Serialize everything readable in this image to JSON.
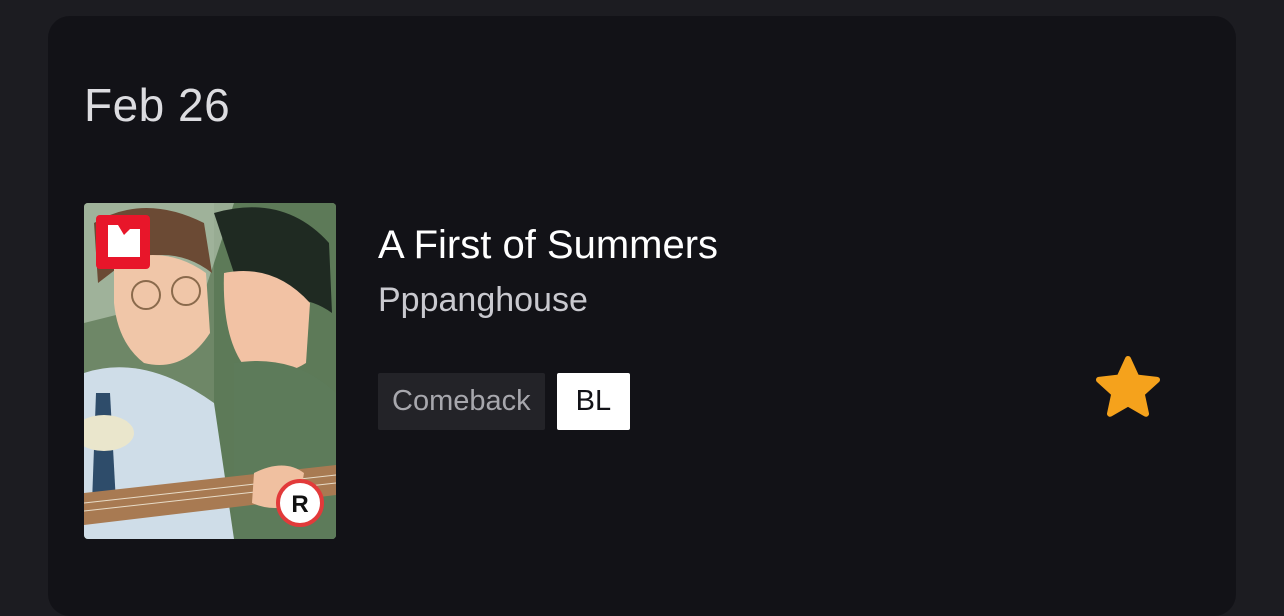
{
  "section": {
    "date": "Feb 26"
  },
  "entry": {
    "title": "A First of Summers",
    "author": "Pppanghouse",
    "tags": [
      "Comeback",
      "BL"
    ],
    "rating_badge": "R",
    "platform_logo": "red-square-logo",
    "favorite_icon": "star-icon",
    "colors": {
      "favorite_star": "#f5a21c",
      "platform_badge": "#e8162a",
      "rating_ring": "#e23a3a"
    }
  }
}
